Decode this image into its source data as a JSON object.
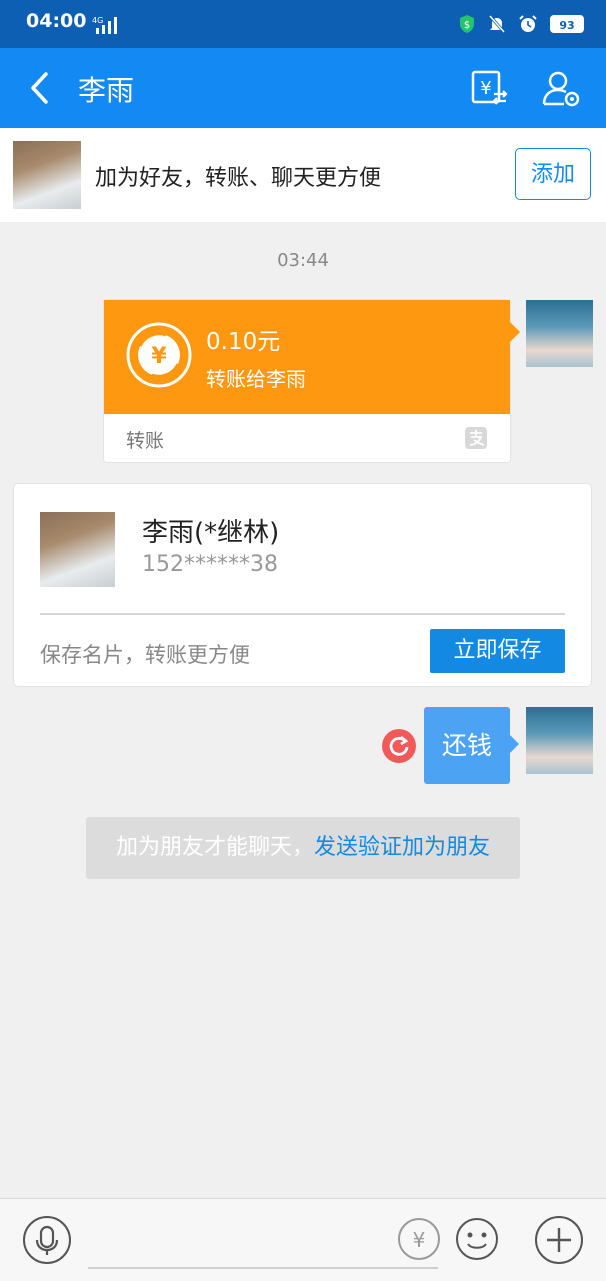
{
  "status_bar": {
    "time": "04:00",
    "network": "4G",
    "battery": "93"
  },
  "header": {
    "title": "李雨"
  },
  "add_friend_banner": {
    "text": "加为好友，转账、聊天更方便",
    "button_label": "添加"
  },
  "chat": {
    "timestamp": "03:44",
    "transfer": {
      "amount": "0.10元",
      "description": "转账给李雨",
      "footer_label": "转账"
    },
    "contact_card": {
      "name": "李雨(*继林)",
      "phone": "152******38",
      "hint": "保存名片，转账更方便",
      "save_button": "立即保存"
    },
    "text_message": "还钱",
    "notice": {
      "text": "加为朋友才能聊天，",
      "link": "发送验证加为朋友"
    }
  },
  "icons": {
    "back": "back-arrow-icon",
    "transfer": "transfer-yuan-icon",
    "profile": "contact-settings-icon",
    "resend": "resend-icon",
    "mic": "microphone-icon",
    "money": "yuan-transfer-icon",
    "emoji": "emoji-icon",
    "more": "plus-icon"
  },
  "colors": {
    "header_blue": "#1389f3",
    "status_blue": "#0d5fb3",
    "transfer_orange": "#fd9810",
    "bubble_blue": "#4ca3f4",
    "link_blue": "#1389e2"
  }
}
